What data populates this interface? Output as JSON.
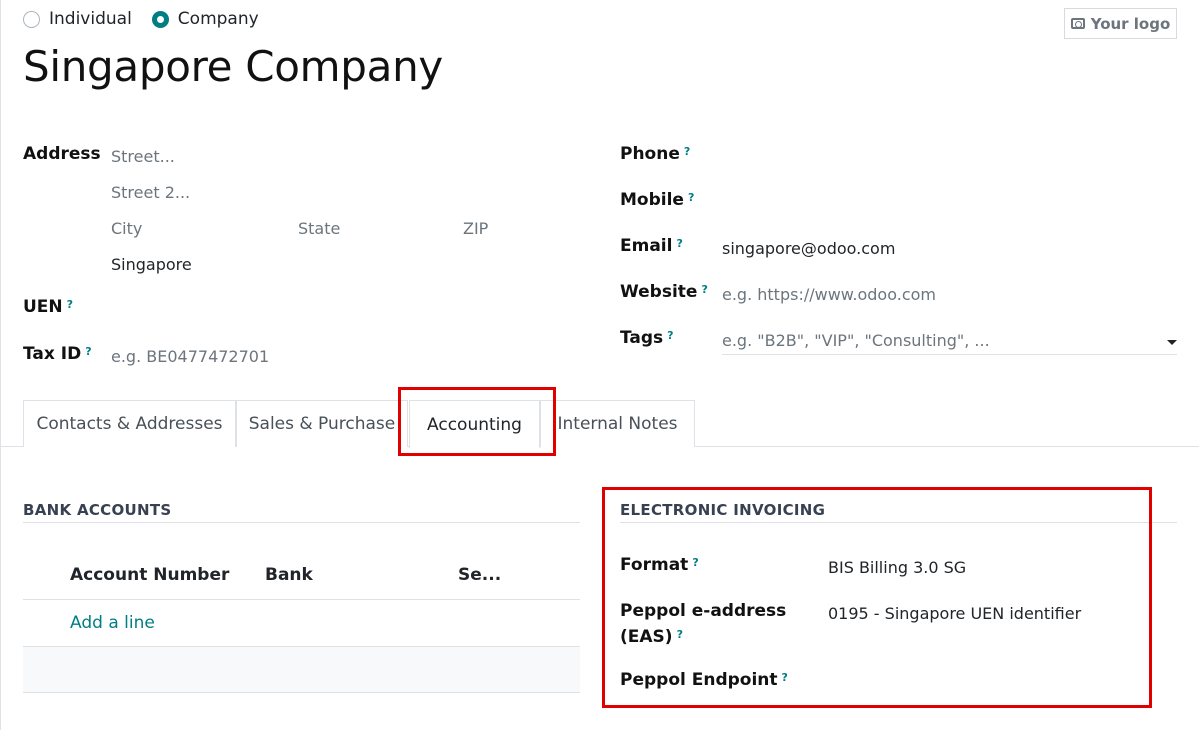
{
  "company_type": {
    "options": [
      {
        "label": "Individual",
        "selected": false
      },
      {
        "label": "Company",
        "selected": true
      }
    ]
  },
  "logo_button": {
    "label": "Your logo",
    "icon": "camera-icon"
  },
  "name": "Singapore Company",
  "address": {
    "label": "Address",
    "street_placeholder": "Street...",
    "street2_placeholder": "Street 2...",
    "city_placeholder": "City",
    "state_placeholder": "State",
    "zip_placeholder": "ZIP",
    "country": "Singapore"
  },
  "uen": {
    "label": "UEN",
    "help": "?"
  },
  "tax_id": {
    "label": "Tax ID",
    "help": "?",
    "placeholder": "e.g. BE0477472701"
  },
  "phone": {
    "label": "Phone",
    "help": "?"
  },
  "mobile": {
    "label": "Mobile",
    "help": "?"
  },
  "email": {
    "label": "Email",
    "help": "?",
    "value": "singapore@odoo.com"
  },
  "website": {
    "label": "Website",
    "help": "?",
    "placeholder": "e.g. https://www.odoo.com"
  },
  "tags": {
    "label": "Tags",
    "help": "?",
    "placeholder": "e.g. \"B2B\", \"VIP\", \"Consulting\", ..."
  },
  "tabs": [
    {
      "label": "Contacts & Addresses",
      "active": false
    },
    {
      "label": "Sales & Purchase",
      "active": false
    },
    {
      "label": "Accounting",
      "active": true
    },
    {
      "label": "Internal Notes",
      "active": false
    }
  ],
  "bank_accounts": {
    "title": "BANK ACCOUNTS",
    "columns": [
      "Account Number",
      "Bank",
      "Se..."
    ],
    "add_line": "Add a line"
  },
  "electronic_invoicing": {
    "title": "ELECTRONIC INVOICING",
    "format_label": "Format",
    "format_value": "BIS Billing 3.0 SG",
    "eas_label_line1": "Peppol e-address",
    "eas_label_line2": "(EAS)",
    "eas_value": "0195 - Singapore UEN identifier",
    "endpoint_label": "Peppol Endpoint",
    "help": "?"
  },
  "colors": {
    "accent": "#017e84",
    "highlight": "#e00000"
  }
}
